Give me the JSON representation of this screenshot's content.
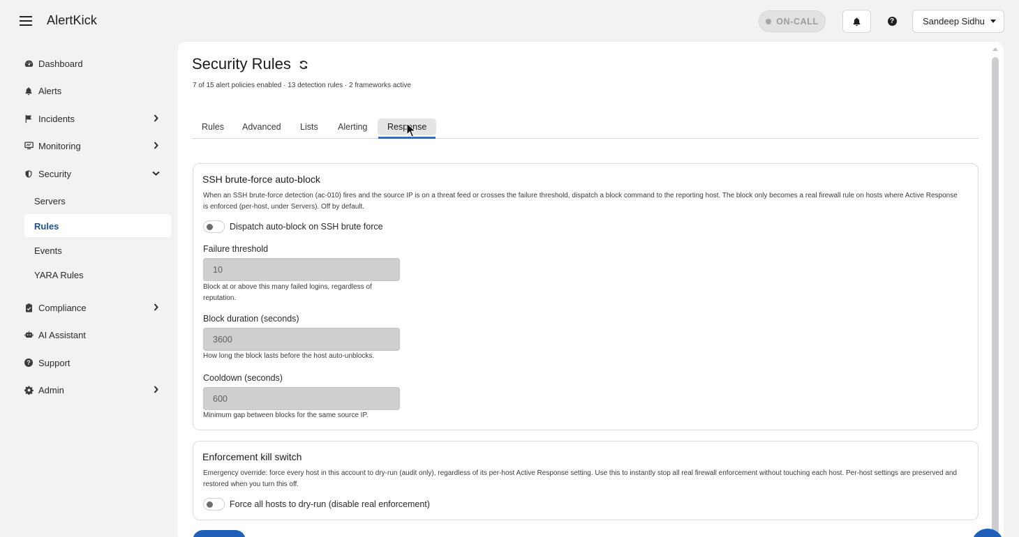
{
  "app": {
    "name": "AlertKick"
  },
  "header": {
    "oncall_label": "ON-CALL",
    "user_name": "Sandeep Sidhu"
  },
  "sidebar": {
    "items": [
      {
        "label": "Dashboard",
        "icon": "dashboard-gauge-icon"
      },
      {
        "label": "Alerts",
        "icon": "bell-icon"
      },
      {
        "label": "Incidents",
        "icon": "flag-icon",
        "expandable": true
      },
      {
        "label": "Monitoring",
        "icon": "monitor-icon",
        "expandable": true
      },
      {
        "label": "Security",
        "icon": "shield-icon",
        "expanded": true,
        "children": [
          "Servers",
          "Rules",
          "Events",
          "YARA Rules"
        ],
        "active_child": "Rules"
      },
      {
        "label": "Compliance",
        "icon": "clipboard-check-icon",
        "expandable": true
      },
      {
        "label": "AI Assistant",
        "icon": "robot-icon"
      },
      {
        "label": "Support",
        "icon": "question-circle-icon"
      },
      {
        "label": "Admin",
        "icon": "gear-icon",
        "expandable": true
      }
    ]
  },
  "page": {
    "title": "Security Rules",
    "summary": "7 of 15 alert policies enabled · 13 detection rules · 2 frameworks active",
    "tabs": [
      "Rules",
      "Advanced",
      "Lists",
      "Alerting",
      "Response"
    ],
    "active_tab": "Response"
  },
  "ssh_card": {
    "title": "SSH brute-force auto-block",
    "description": "When an SSH brute-force detection (ac-010) fires and the source IP is on a threat feed or crosses the failure threshold, dispatch a block command to the reporting host. The block only becomes a real firewall rule on hosts where Active Response is enforced (per-host, under Servers). Off by default.",
    "toggle_label": "Dispatch auto-block on SSH brute force",
    "toggle_on": false,
    "fields": [
      {
        "label": "Failure threshold",
        "value": "10",
        "help": "Block at or above this many failed logins, regardless of reputation."
      },
      {
        "label": "Block duration (seconds)",
        "value": "3600",
        "help": "How long the block lasts before the host auto-unblocks."
      },
      {
        "label": "Cooldown (seconds)",
        "value": "600",
        "help": "Minimum gap between blocks for the same source IP."
      }
    ]
  },
  "kill_card": {
    "title": "Enforcement kill switch",
    "description": "Emergency override: force every host in this account to dry-run (audit only), regardless of its per-host Active Response setting. Use this to instantly stop all real firewall enforcement without touching each host. Per-host settings are preserved and restored when you turn this off.",
    "toggle_label": "Force all hosts to dry-run (disable real enforcement)",
    "toggle_on": false
  },
  "colors": {
    "accent": "#2f6cc5",
    "active_nav_text": "#1f4f91",
    "primary_button": "#1f5fb8"
  }
}
